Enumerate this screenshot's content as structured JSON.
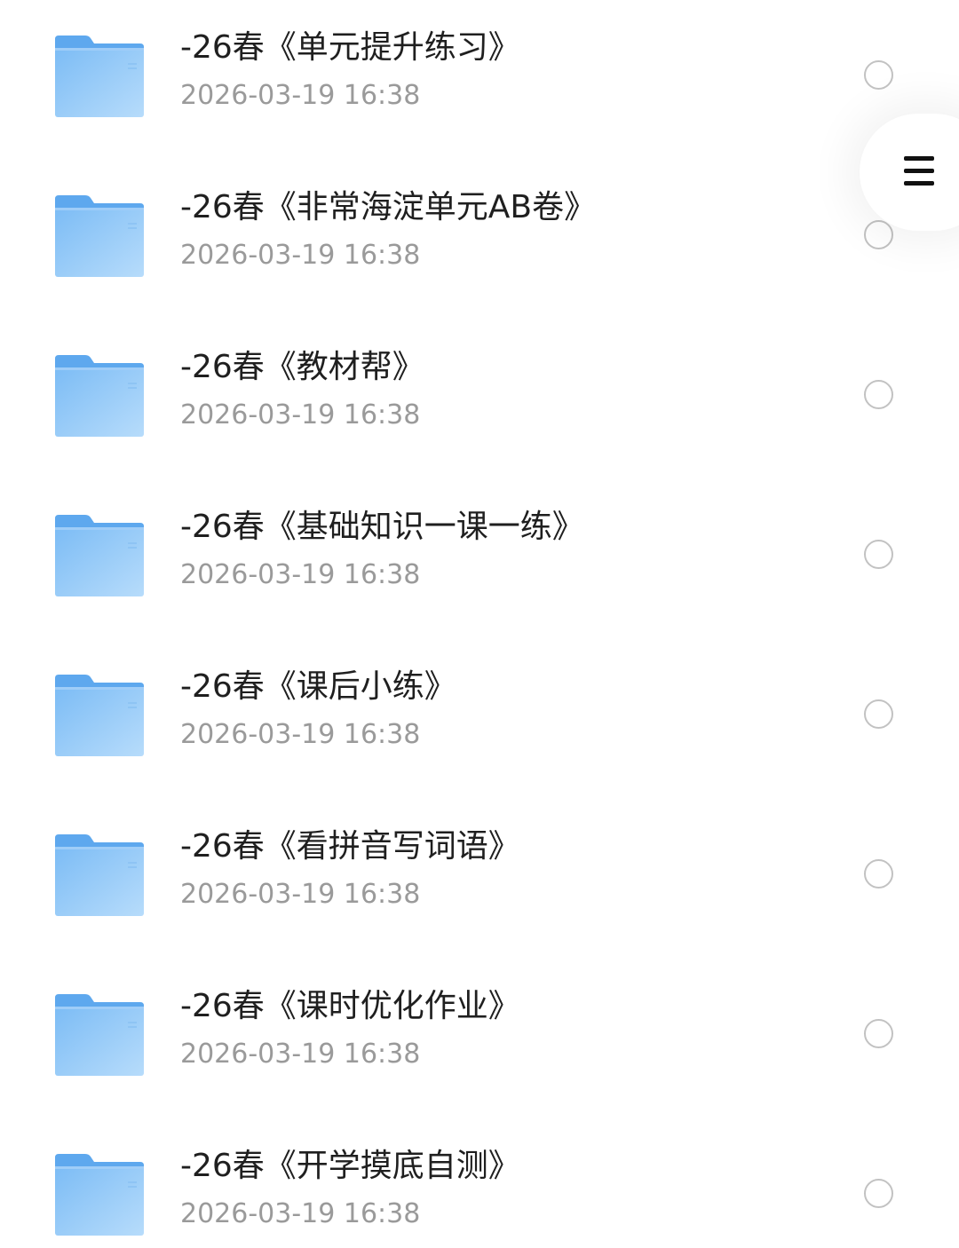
{
  "files": [
    {
      "name": "-26春《单元提升练习》",
      "date": "2026-03-19 16:38",
      "icon": "folder-icon"
    },
    {
      "name": "-26春《非常海淀单元AB卷》",
      "date": "2026-03-19 16:38",
      "icon": "folder-icon"
    },
    {
      "name": "-26春《教材帮》",
      "date": "2026-03-19 16:38",
      "icon": "folder-icon"
    },
    {
      "name": "-26春《基础知识一课一练》",
      "date": "2026-03-19 16:38",
      "icon": "folder-icon"
    },
    {
      "name": "-26春《课后小练》",
      "date": "2026-03-19 16:38",
      "icon": "folder-icon"
    },
    {
      "name": "-26春《看拼音写词语》",
      "date": "2026-03-19 16:38",
      "icon": "folder-icon"
    },
    {
      "name": "-26春《课时优化作业》",
      "date": "2026-03-19 16:38",
      "icon": "folder-icon"
    },
    {
      "name": "-26春《开学摸底自测》",
      "date": "2026-03-19 16:38",
      "icon": "folder-icon"
    }
  ],
  "floating_menu": {
    "icon": "menu-icon"
  },
  "colors": {
    "folder_light": "#a9d4fa",
    "folder_mid": "#7cbcf5",
    "folder_dark": "#5ea8ee",
    "title_text": "#1f1f1f",
    "date_text": "#9a9a9a",
    "radio_border": "#c2c2c2"
  }
}
